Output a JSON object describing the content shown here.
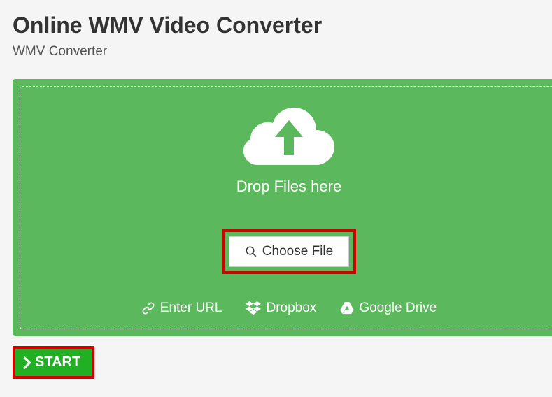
{
  "header": {
    "title": "Online WMV Video Converter",
    "subtitle": "WMV Converter"
  },
  "dropzone": {
    "drop_text": "Drop Files here",
    "choose_file_label": "Choose File",
    "sources": {
      "url": "Enter URL",
      "dropbox": "Dropbox",
      "gdrive": "Google Drive"
    }
  },
  "actions": {
    "start_label": "START"
  },
  "colors": {
    "accent_green": "#5cb85c",
    "start_green": "#21b024",
    "highlight_red": "#d40000"
  }
}
